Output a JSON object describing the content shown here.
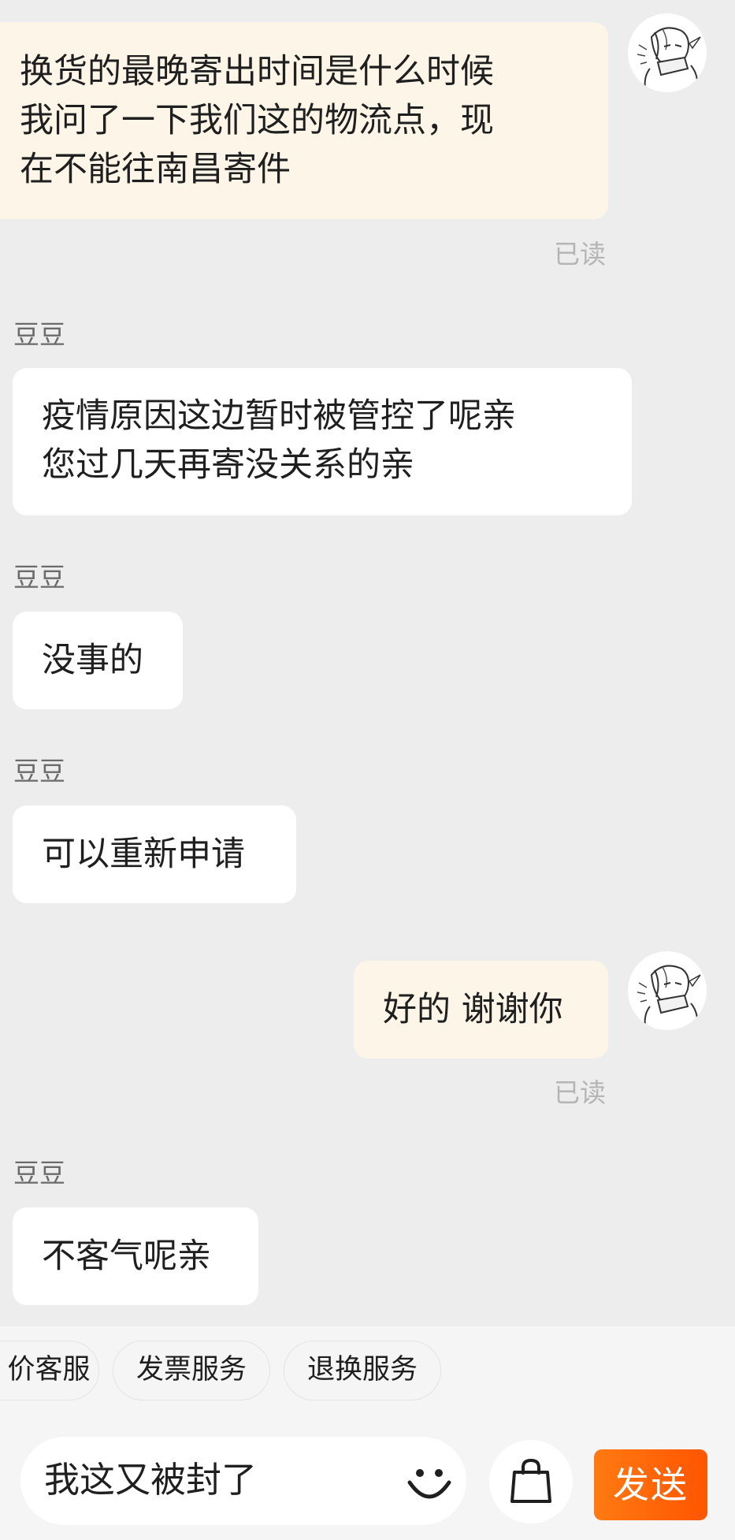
{
  "messages": [
    {
      "side": "me",
      "text": "换货的最晚寄出时间是什么时候\n我问了一下我们这的物流点，现\n在不能往南昌寄件",
      "status": "已读"
    },
    {
      "side": "them",
      "sender": "豆豆",
      "text": "疫情原因这边暂时被管控了呢亲\n您过几天再寄没关系的亲"
    },
    {
      "side": "them",
      "sender": "豆豆",
      "text": "没事的"
    },
    {
      "side": "them",
      "sender": "豆豆",
      "text": "可以重新申请"
    },
    {
      "side": "me",
      "text": "好的 谢谢你",
      "status": "已读"
    },
    {
      "side": "them",
      "sender": "豆豆",
      "text": "不客气呢亲"
    }
  ],
  "quick_actions": [
    "价客服",
    "发票服务",
    "退换服务"
  ],
  "input": {
    "value": "我这又被封了"
  },
  "send_label": "发送",
  "icons": {
    "avatar": "sketch-avatar",
    "emoji": "smile-icon",
    "shop": "shopping-bag-icon"
  },
  "colors": {
    "chat_background": "#ededed",
    "my_bubble": "#fdf6e8",
    "their_bubble": "#ffffff",
    "send_button": "#ff5500"
  }
}
